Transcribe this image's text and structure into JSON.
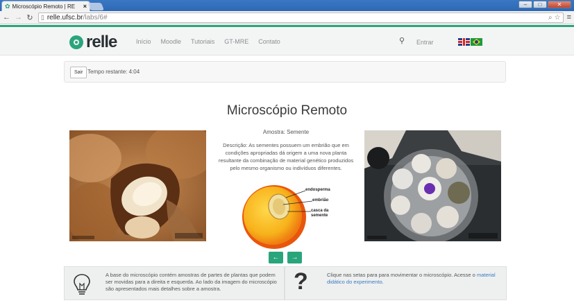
{
  "browser": {
    "tab_title": "Microscópio Remoto | RE",
    "tab_close": "×",
    "url_host": "relle.ufsc.br",
    "url_path": "/labs/6#"
  },
  "header": {
    "logo_text": "relle",
    "nav": [
      "Início",
      "Moodle",
      "Tutoriais",
      "GT-MRE",
      "Contato"
    ],
    "login_label": "Entrar"
  },
  "session": {
    "exit_label": "Sair",
    "time_remaining": "Tempo restante: 4:04"
  },
  "main": {
    "title": "Microscópio Remoto",
    "sample_label": "Amostra: Semente",
    "description": "Descrição: As sementes possuem um embrião que em condições apropriadas dá origem a uma nova planta resultante da combinação de material genético produzidos pelo mesmo organismo ou indivíduos diferentes.",
    "diagram_labels": [
      "endosperma",
      "embrião",
      "casca da semente"
    ],
    "prev_arrow": "←",
    "next_arrow": "→"
  },
  "info": {
    "tip_text": "A base do microscópio contém amostras de partes de plantas que podem ser movidas para a direita e esquerda. Ao lado da imagem do microscópio são apresentados mais detalhes sobre a amostra.",
    "help_text": "Clique nas setas para para movimentar o microscópio. Acesse o",
    "help_link": "material didático do experimento",
    "help_suffix": ".",
    "help_symbol": "?"
  },
  "colors": {
    "accent": "#2aa57b"
  },
  "icons": {
    "tip": "lightbulb-icon",
    "help": "question-mark-icon",
    "search": "search-icon"
  }
}
